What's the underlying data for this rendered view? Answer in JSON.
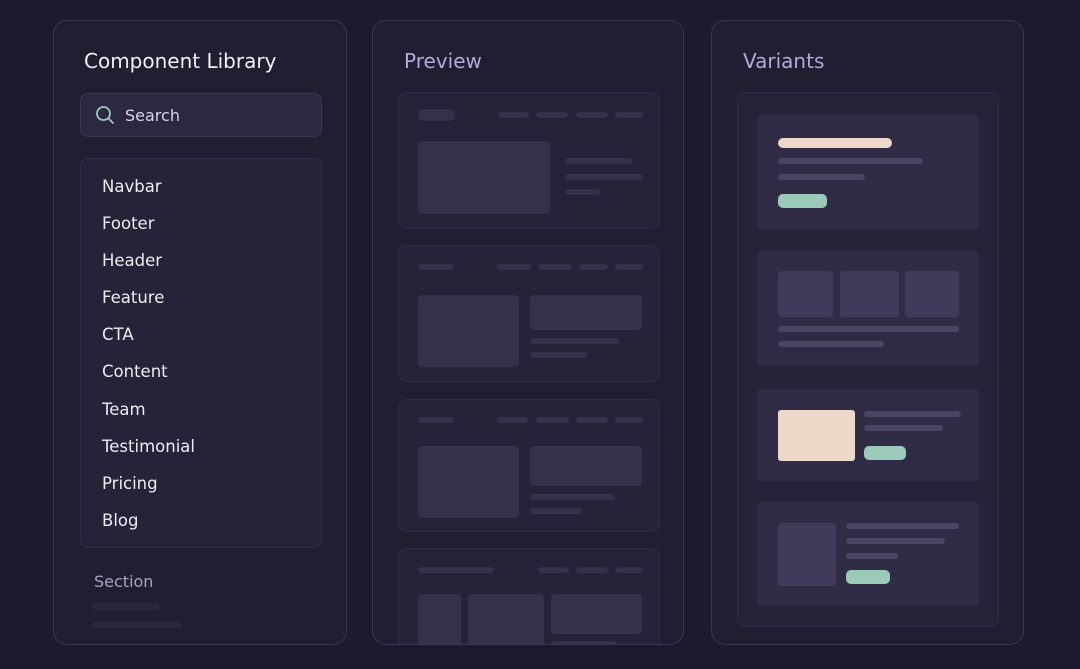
{
  "library": {
    "title": "Component Library",
    "search_placeholder": "Search",
    "items": [
      {
        "label": "Navbar"
      },
      {
        "label": "Footer"
      },
      {
        "label": "Header"
      },
      {
        "label": "Feature"
      },
      {
        "label": "CTA"
      },
      {
        "label": "Content"
      },
      {
        "label": "Team"
      },
      {
        "label": "Testimonial"
      },
      {
        "label": "Pricing"
      },
      {
        "label": "Blog"
      }
    ],
    "section_label": "Section"
  },
  "preview": {
    "title": "Preview"
  },
  "variants": {
    "title": "Variants"
  },
  "colors": {
    "accent_mint": "#9ccab8",
    "accent_cream": "#ecd8c9"
  },
  "icons": {
    "search": "search-icon"
  }
}
